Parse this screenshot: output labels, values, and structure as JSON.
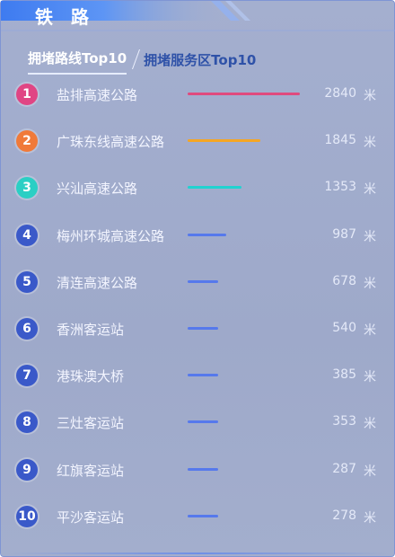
{
  "header": {
    "title": "铁路"
  },
  "tabs": [
    {
      "label": "拥堵路线Top10",
      "active": true
    },
    {
      "label": "拥堵服务区Top10",
      "active": false
    }
  ],
  "unit_label": "米",
  "max_value": 2840,
  "colors": {
    "rank1": "#e04584",
    "rank2": "#f07a3a",
    "rank3": "#2bcfc4",
    "rank_default": "#3a59c9",
    "bar1": "#e04a7e",
    "bar2": "#f5a623",
    "bar3": "#21d2d0",
    "bar_default": "#5679ec"
  },
  "items": [
    {
      "rank": "1",
      "name": "盐排高速公路",
      "value": 2840
    },
    {
      "rank": "2",
      "name": "广珠东线高速公路",
      "value": 1845
    },
    {
      "rank": "3",
      "name": "兴汕高速公路",
      "value": 1353
    },
    {
      "rank": "4",
      "name": "梅州环城高速公路",
      "value": 987
    },
    {
      "rank": "5",
      "name": "清连高速公路",
      "value": 678
    },
    {
      "rank": "6",
      "name": "香洲客运站",
      "value": 540
    },
    {
      "rank": "7",
      "name": "港珠澳大桥",
      "value": 385
    },
    {
      "rank": "8",
      "name": "三灶客运站",
      "value": 353
    },
    {
      "rank": "9",
      "name": "红旗客运站",
      "value": 287
    },
    {
      "rank": "10",
      "name": "平沙客运站",
      "value": 278
    }
  ]
}
